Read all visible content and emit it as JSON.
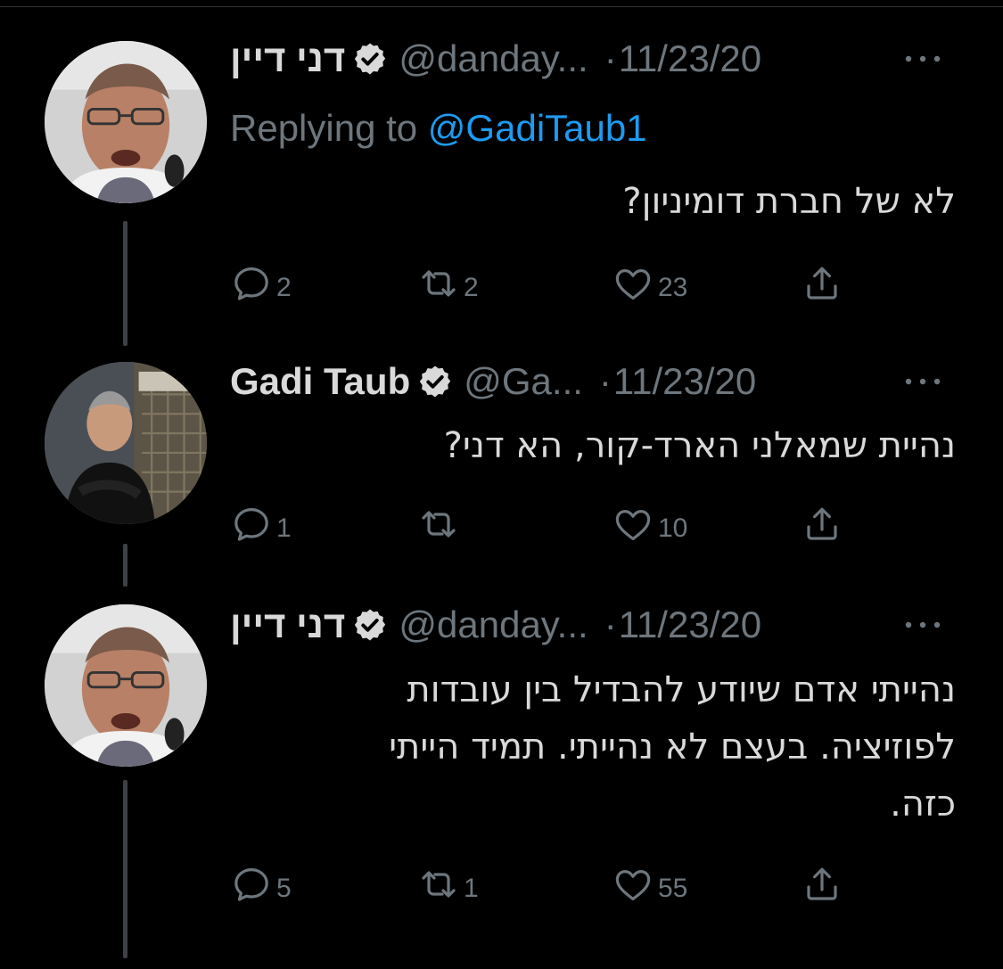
{
  "tweets": [
    {
      "name": "דני דיין",
      "handle": "@danday...",
      "dot": "·",
      "time": "11/23/20",
      "replying_prefix": "Replying to",
      "replying_to": "@GadiTaub1",
      "text": "לא של חברת דומיניון?",
      "counts": {
        "reply": "2",
        "retweet": "2",
        "like": "23"
      }
    },
    {
      "name": "Gadi Taub",
      "handle": "@Ga...",
      "dot": "·",
      "time": "11/23/20",
      "text": "נהיית שמאלני הארד-קור, הא דני?",
      "counts": {
        "reply": "1",
        "retweet": "",
        "like": "10"
      }
    },
    {
      "name": "דני דיין",
      "handle": "@danday...",
      "dot": "·",
      "time": "11/23/20",
      "text_lines": [
        "נהייתי אדם שיודע להבדיל בין עובדות",
        "לפוזיציה. בעצם לא נהייתי. תמיד הייתי",
        "כזה."
      ],
      "counts": {
        "reply": "5",
        "retweet": "1",
        "like": "55"
      }
    }
  ],
  "icons": {
    "reply": "reply-icon",
    "retweet": "retweet-icon",
    "like": "heart-icon",
    "share": "share-icon",
    "verified": "verified-badge-icon",
    "more": "more-options-icon"
  },
  "colors": {
    "background": "#000000",
    "text": "#d9d9d9",
    "muted": "#6e767d",
    "link": "#1d9bf0",
    "thread_line": "#3d4145"
  }
}
